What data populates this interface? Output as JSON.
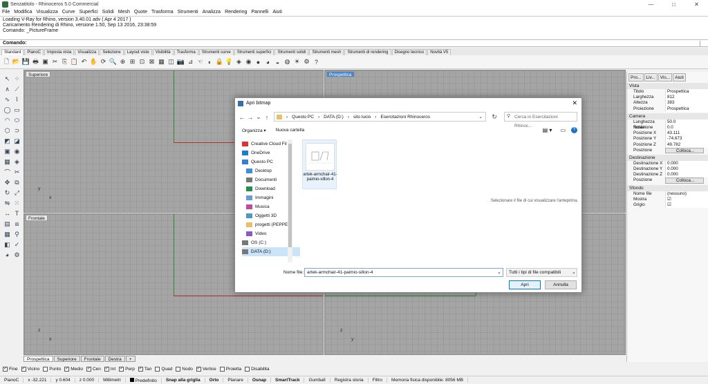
{
  "window": {
    "title": "Senzatitolo - Rhinoceros 5.0 Commercial",
    "controls": [
      "—",
      "□",
      "✕"
    ]
  },
  "menu": [
    "File",
    "Modifica",
    "Visualizza",
    "Curve",
    "Superfici",
    "Solidi",
    "Mesh",
    "Quote",
    "Trasforma",
    "Strumenti",
    "Analizza",
    "Rendering",
    "Pannelli",
    "Aiuti"
  ],
  "history": [
    "Loading V-Ray for Rhino, version 3.40.01 adv ( Apr  4 2017 )",
    "Caricamento Rendering di Rhino, versione 1.50, Sep 13 2016, 23:38:59",
    "Comando: _PictureFrame"
  ],
  "command": {
    "label": "Comando:"
  },
  "tabs": [
    "Standard",
    "PianoC",
    "Imposta vista",
    "Visualizza",
    "Selezione",
    "Layout viste",
    "Visibilità",
    "Trasforma",
    "Strumenti curve",
    "Strumenti superfici",
    "Strumenti solidi",
    "Strumenti mesh",
    "Strumenti di rendering",
    "Disegno tecnico",
    "Novità V5"
  ],
  "viewports": {
    "top": "Superiore",
    "persp": "Prospettica",
    "front": "Frontale",
    "x": "x",
    "y": "y",
    "z": "z"
  },
  "viewport_tabs": [
    "Prospettica",
    "Superiore",
    "Frontale",
    "Destra",
    "+"
  ],
  "osnaps": [
    {
      "label": "Fine",
      "checked": true
    },
    {
      "label": "Vicino",
      "checked": true
    },
    {
      "label": "Punto",
      "checked": false
    },
    {
      "label": "Medio",
      "checked": true
    },
    {
      "label": "Cen",
      "checked": true
    },
    {
      "label": "Int",
      "checked": true
    },
    {
      "label": "Perp",
      "checked": true
    },
    {
      "label": "Tan",
      "checked": true
    },
    {
      "label": "Quad",
      "checked": false
    },
    {
      "label": "Nodo",
      "checked": false
    },
    {
      "label": "Vertice",
      "checked": true
    },
    {
      "label": "Proietta",
      "checked": false
    },
    {
      "label": "Disabilita",
      "checked": false
    }
  ],
  "status": {
    "cplane": "PianoC",
    "x": "x -32.221",
    "y": "y 0.604",
    "z": "z 0.000",
    "units": "Millimetri",
    "layer": "Predefinito",
    "grid_snap": "Snap alla griglia",
    "ortho": "Orto",
    "planar": "Planare",
    "osnap": "Osnap",
    "smarttrack": "SmartTrack",
    "gumball": "Gumball",
    "history": "Registra storia",
    "filter": "Filtro",
    "memory": "Memoria fisica disponibile: 8056 MB"
  },
  "panel": {
    "tabs": [
      "Pro...",
      "Liv...",
      "Vis...",
      "Aiuti"
    ],
    "sections": {
      "vista": "Vista",
      "camera": "Camera",
      "target": "Destinazione",
      "background": "Sfondo"
    },
    "vista": [
      {
        "k": "Titolo",
        "v": "Prospettica"
      },
      {
        "k": "Larghezza",
        "v": "812"
      },
      {
        "k": "Altezza",
        "v": "383"
      },
      {
        "k": "Proiezione",
        "v": "Prospettica"
      }
    ],
    "camera": [
      {
        "k": "Lunghezza focale",
        "v": "50.0"
      },
      {
        "k": "Rotazione",
        "v": "0.0"
      },
      {
        "k": "Posizione X",
        "v": "43.111"
      },
      {
        "k": "Posizione Y",
        "v": "-74.673"
      },
      {
        "k": "Posizione Z",
        "v": "49.782"
      },
      {
        "k": "Posizione",
        "v": "Colloca..."
      }
    ],
    "target": [
      {
        "k": "Destinazione X",
        "v": "0.000"
      },
      {
        "k": "Destinazione Y",
        "v": "0.000"
      },
      {
        "k": "Destinazione Z",
        "v": "0.000"
      },
      {
        "k": "Posizione",
        "v": "Colloca..."
      }
    ],
    "background": [
      {
        "k": "Nome file",
        "v": "(nessuno)"
      },
      {
        "k": "Mostra",
        "v": "☑"
      },
      {
        "k": "Grigio",
        "v": "☑"
      }
    ]
  },
  "dialog": {
    "title": "Apri bitmap",
    "close": "✕",
    "path": [
      "Questo PC",
      "DATA (D:)",
      "sito lucio",
      "Esercitazioni Rhinoceros"
    ],
    "search_placeholder": "Cerca in Esercitazioni Rhinoc...",
    "organize": "Organizza ▾",
    "new_folder": "Nuova cartella",
    "nav": [
      "Creative Cloud Fil",
      "OneDrive",
      "Questo PC",
      "Desktop",
      "Documenti",
      "Download",
      "Immagini",
      "Musica",
      "Oggetti 3D",
      "progetti (PEPPE)",
      "Video",
      "OS (C:)",
      "DATA (D:)"
    ],
    "file": {
      "name": "artek-armchair-41-paimio-sillon-4"
    },
    "preview": "Selezionare il file di cui visualizzare l'anteprima.",
    "filename_label": "Nome file:",
    "filename_value": "artek-armchair-41-paimio-sillon-4",
    "filter": "Tutti i tipi di file compatibili",
    "open": "Apri",
    "cancel": "Annulla"
  }
}
